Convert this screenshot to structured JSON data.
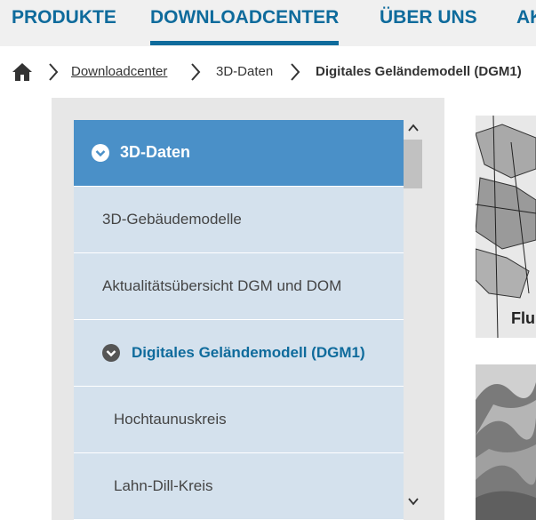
{
  "topnav": {
    "items": [
      "PRODUKTE",
      "DOWNLOADCENTER",
      "ÜBER UNS",
      "AK"
    ],
    "active_index": 1
  },
  "breadcrumb": {
    "home_icon": "home-icon",
    "items": [
      "Downloadcenter",
      "3D-Daten",
      "Digitales Geländemodell (DGM1)"
    ]
  },
  "sidebar": {
    "header": "3D-Daten",
    "items": [
      "3D-Gebäudemodelle",
      "Aktualitätsübersicht DGM und DOM"
    ],
    "current": "Digitales Geländemodell (DGM1)",
    "children": [
      "Hochtaunuskreis",
      "Lahn-Dill-Kreis"
    ]
  },
  "thumbnail": {
    "map_label": "Flu"
  },
  "colors": {
    "brand": "#0f6b9c",
    "header_bg": "#4a90c8",
    "item_bg": "#d4e1ed",
    "sidebar_bg": "#e7e7e7"
  }
}
